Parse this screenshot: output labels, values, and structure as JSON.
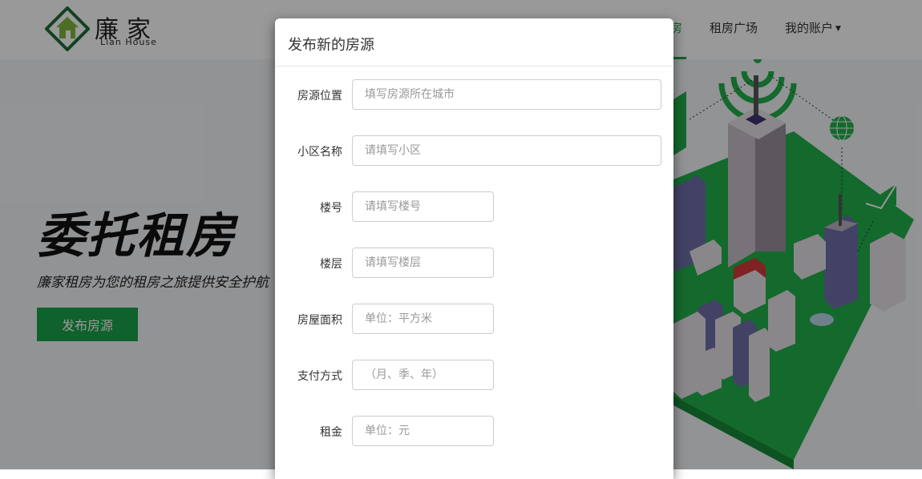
{
  "brand": {
    "name": "廉家",
    "subtitle": "Lian House"
  },
  "nav": {
    "items": [
      "房",
      "租房广场",
      "我的账户"
    ]
  },
  "hero": {
    "title": "委托租房",
    "subtitle": "廉家租房为您的租房之旅提供安全护航",
    "button": "发布房源"
  },
  "modal": {
    "title": "发布新的房源",
    "fields": [
      {
        "label": "房源位置",
        "placeholder": "填写房源所在城市"
      },
      {
        "label": "小区名称",
        "placeholder": "请填写小区"
      },
      {
        "label": "楼号",
        "placeholder": "请填写楼号"
      },
      {
        "label": "楼层",
        "placeholder": "请填写楼层"
      },
      {
        "label": "房屋面积",
        "placeholder": "单位：平方米"
      },
      {
        "label": "支付方式",
        "placeholder": "（月、季、年）"
      },
      {
        "label": "租金",
        "placeholder": "单位：元"
      }
    ]
  },
  "colors": {
    "brand_green": "#1aa34a",
    "city_green": "#22b04b"
  }
}
